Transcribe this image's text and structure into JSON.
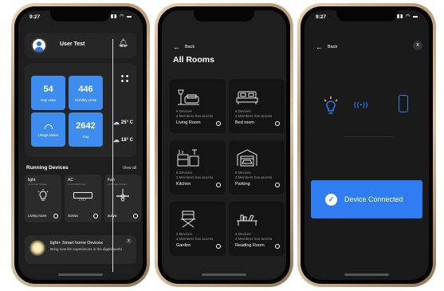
{
  "status": {
    "time": "9:27",
    "icons": "▮▮ ◠ ▬"
  },
  "home": {
    "user_name": "User Test",
    "tiles": [
      {
        "value": "54",
        "label": "Day units"
      },
      {
        "value": "446",
        "label": "Monthly Units"
      },
      {
        "value": "",
        "label": "Usage Meter"
      },
      {
        "value": "2642",
        "label": "Pay"
      }
    ],
    "weather": [
      {
        "temp": "25° C"
      },
      {
        "temp": "18° C"
      }
    ],
    "running_title": "Running Devices",
    "view_all": "View all",
    "devices": [
      {
        "name": "light",
        "sub": "on for last 4 hours",
        "room": "Living room"
      },
      {
        "name": "AC",
        "sub": "on for last 1 hour",
        "room": "Sonsa"
      },
      {
        "name": "Fan",
        "sub": "on for last 4 hours",
        "room": "aorya"
      }
    ],
    "promo": {
      "title": "light+ Smart home Devices",
      "text": "Bring new life experiences in the digital world",
      "close": "x"
    }
  },
  "rooms": {
    "back": "Back",
    "title": "All Rooms",
    "items": [
      {
        "devices": "6 Devices",
        "access": "4 Members has access",
        "name": "Living Room",
        "icon": "lamp-sofa-icon"
      },
      {
        "devices": "6 Devices",
        "access": "4 Members has access",
        "name": "Bed room",
        "icon": "bed-icon"
      },
      {
        "devices": "6 Devices",
        "access": "4 Members has access",
        "name": "Kitchen",
        "icon": "kitchen-icon"
      },
      {
        "devices": "6 Devices",
        "access": "4 Members has access",
        "name": "Parking",
        "icon": "garage-icon"
      },
      {
        "devices": "6 Devices",
        "access": "4 Members has access",
        "name": "Garden",
        "icon": "chair-icon"
      },
      {
        "devices": "6 Devices",
        "access": "4 Members has access",
        "name": "Reading Room",
        "icon": "bookshelf-icon"
      }
    ]
  },
  "connected": {
    "back": "Back",
    "close": "x",
    "message": "Device Connected",
    "accent": "#2f7df0"
  }
}
